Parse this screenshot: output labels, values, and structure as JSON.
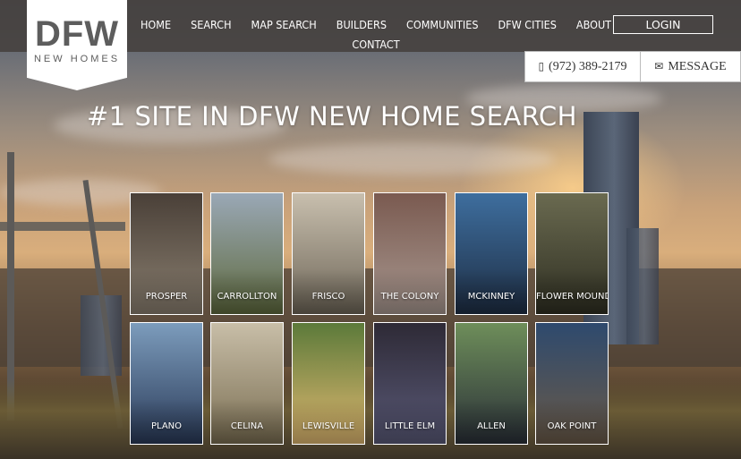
{
  "brand": {
    "mark": "DFW",
    "sub": "NEW HOMES"
  },
  "nav": {
    "items": [
      "HOME",
      "SEARCH",
      "MAP SEARCH",
      "BUILDERS",
      "COMMUNITIES",
      "DFW CITIES",
      "ABOUT"
    ],
    "second_row": [
      "CONTACT"
    ],
    "login": "LOGIN"
  },
  "cta": {
    "phone": "(972) 389-2179",
    "message": "MESSAGE"
  },
  "headline": "#1 SITE IN DFW NEW HOME SEARCH",
  "cities": [
    {
      "label": "PROSPER",
      "color_top": "#4a4038",
      "color_bottom": "#8a7f70"
    },
    {
      "label": "CARROLLTON",
      "color_top": "#9aa8b6",
      "color_bottom": "#5f6a3e"
    },
    {
      "label": "FRISCO",
      "color_top": "#c8bfae",
      "color_bottom": "#6e6658"
    },
    {
      "label": "THE COLONY",
      "color_top": "#7a5a50",
      "color_bottom": "#a89890"
    },
    {
      "label": "MCKINNEY",
      "color_top": "#3e6e9e",
      "color_bottom": "#1e2e44"
    },
    {
      "label": "FLOWER MOUND",
      "color_top": "#6a6a50",
      "color_bottom": "#2f2f22"
    },
    {
      "label": "PLANO",
      "color_top": "#7c9cbc",
      "color_bottom": "#2a3a58"
    },
    {
      "label": "CELINA",
      "color_top": "#c8bea8",
      "color_bottom": "#7a6e52"
    },
    {
      "label": "LEWISVILLE",
      "color_top": "#5c7a3a",
      "color_bottom": "#e0b870"
    },
    {
      "label": "LITTLE ELM",
      "color_top": "#2e2a36",
      "color_bottom": "#5a5a78"
    },
    {
      "label": "ALLEN",
      "color_top": "#6e8e5a",
      "color_bottom": "#2a3038"
    },
    {
      "label": "OAK POINT",
      "color_top": "#2e4a6e",
      "color_bottom": "#6a5a48"
    }
  ]
}
